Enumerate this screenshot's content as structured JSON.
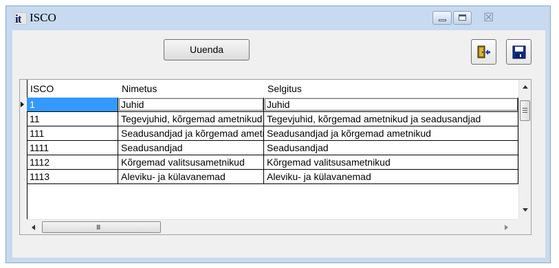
{
  "window": {
    "title": "ISCO",
    "app_icon_letters": "it",
    "accent_color": "#3399ff",
    "frame_color": "#c7daf0"
  },
  "caption_buttons": {
    "minimize_icon": "minimize-icon",
    "maximize_icon": "maximize-icon",
    "close_glyph": "☒",
    "close_icon": "close-icon"
  },
  "toolbar": {
    "refresh_label": "Uuenda",
    "exit_icon": "exit-door-icon",
    "save_icon": "floppy-disk-save-icon"
  },
  "grid": {
    "columns": [
      "ISCO",
      "Nimetus",
      "Selgitus"
    ],
    "rows": [
      {
        "isco": "1",
        "nimetus": "Juhid",
        "selgitus": "Juhid"
      },
      {
        "isco": "11",
        "nimetus": "Tegevjuhid, kõrgemad ametnikud ja seadusandjad",
        "selgitus": "Tegevjuhid, kõrgemad ametnikud ja seadusandjad"
      },
      {
        "isco": "111",
        "nimetus": "Seadusandjad ja kõrgemad ametnikud",
        "selgitus": "Seadusandjad ja kõrgemad ametnikud"
      },
      {
        "isco": "1111",
        "nimetus": "Seadusandjad",
        "selgitus": "Seadusandjad"
      },
      {
        "isco": "1112",
        "nimetus": "Kõrgemad valitsusametnikud",
        "selgitus": "Kõrgemad valitsusametnikud"
      },
      {
        "isco": "1113",
        "nimetus": "Aleviku- ja külavanemad",
        "selgitus": "Aleviku- ja külavanemad"
      }
    ],
    "selected_row": 0,
    "hscroll_grip": "III"
  }
}
